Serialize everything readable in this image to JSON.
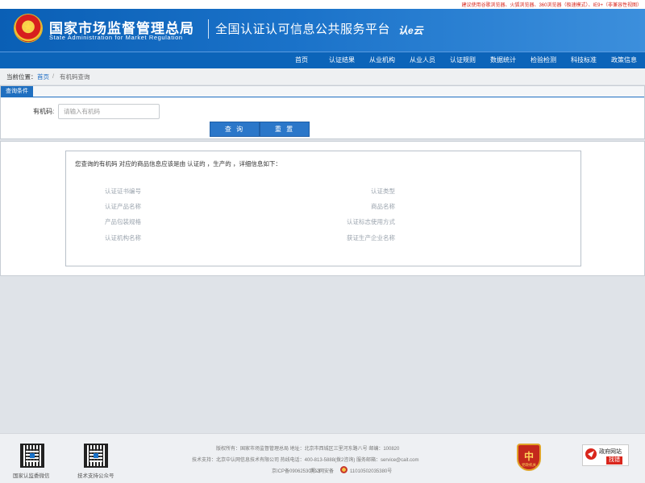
{
  "top_notice": "建议使用谷歌浏览器、火狐浏览器、360浏览器（极速模式）、IE9+（非兼容性视图）",
  "header": {
    "org_cn": "国家市场监督管理总局",
    "org_en": "State Administration  for  Market Regulation",
    "platform": "全国认证认可信息公共服务平台",
    "logo_text": "认e云"
  },
  "nav": {
    "items": [
      "首页",
      "认证结果",
      "从业机构",
      "从业人员",
      "认证规则",
      "数据统计",
      "检验检测",
      "科技标准",
      "政策信息"
    ]
  },
  "breadcrumb": {
    "label": "当前位置：",
    "home": "首页",
    "separator": "/",
    "current": "有机码查询"
  },
  "query": {
    "tab": "查询条件",
    "field_label": "有机码:",
    "placeholder": "请输入有机码",
    "value": "",
    "search_label": "查 询",
    "reset_label": "重 置"
  },
  "result": {
    "intro": "您查询的有机码 对应的商品信息应该是由 认证的 ，生产的 ，详细信息如下：",
    "left_fields": [
      "认证证书编号",
      "认证产品名称",
      "产品包装规格",
      "认证机构名称"
    ],
    "right_fields": [
      "认证类型",
      "商品名称",
      "认证标志使用方式",
      "获证生产企业名称"
    ]
  },
  "footer": {
    "qr_captions": [
      "国家认监委微信",
      "技术支持公众号"
    ],
    "copyright": "版权所有：国家市场监督管理总局    地址：北京市西城区三里河东路八号    邮编：100820",
    "support": "技术支持：北京中认网信息技术有限公司    热线电话：400-813-5888(拨2咨询)    服务邮箱：service@cait.com",
    "icp": "京ICP备09062530号-3",
    "police_record": "京公网安备",
    "police_number": "11010502035380号",
    "badge_text": "党政机关",
    "gov_title": "政府网站",
    "gov_action": "找错"
  },
  "colors": {
    "header_blue": "#0a5fb5",
    "nav_blue": "#0c64b9",
    "button_blue": "#2b77c9",
    "notice_red": "#d9261c"
  }
}
